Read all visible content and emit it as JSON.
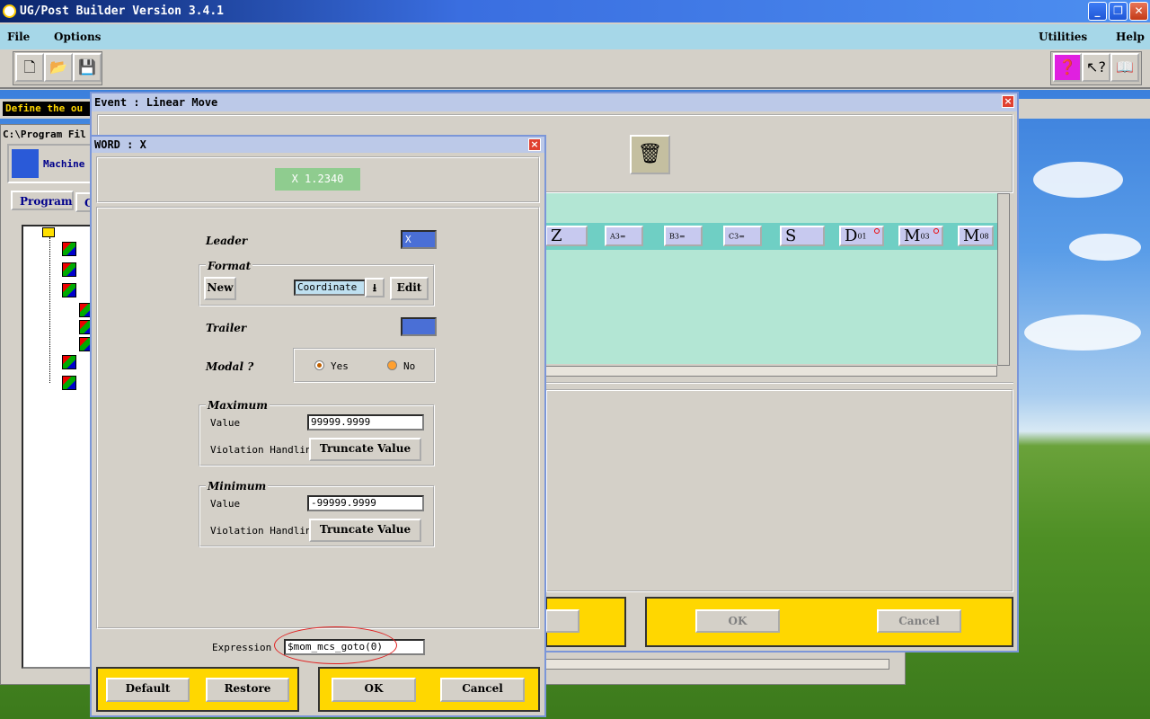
{
  "main_window": {
    "title": "UG/Post Builder Version 3.4.1",
    "menus_left": [
      "File",
      "Options"
    ],
    "menus_right": [
      "Utilities",
      "Help"
    ],
    "minimize": "_",
    "maximize": "❐",
    "close": "✕"
  },
  "status": {
    "message": "Define the ou",
    "path": "C:\\Program Fil"
  },
  "left_panel": {
    "machine_label": "Machine",
    "tabs": [
      "Program",
      "G"
    ]
  },
  "event_window": {
    "title": "Event : Linear Move",
    "blocks": [
      {
        "label": "Z",
        "small": ""
      },
      {
        "label": "",
        "small": "A3="
      },
      {
        "label": "",
        "small": "B3="
      },
      {
        "label": "",
        "small": "C3="
      },
      {
        "label": "S",
        "small": ""
      },
      {
        "label": "D",
        "small": "01"
      },
      {
        "label": "M",
        "small": "03"
      },
      {
        "label": "M",
        "small": "08"
      }
    ],
    "ok_label": "OK",
    "cancel_label": "Cancel"
  },
  "word_dialog": {
    "title": "WORD : X",
    "preview": "X   1.2340",
    "leader_label": "Leader",
    "leader_value": "X",
    "format_label": "Format",
    "new_label": "New",
    "format_value": "Coordinate",
    "edit_label": "Edit",
    "trailer_label": "Trailer",
    "modal_label": "Modal ?",
    "modal_yes": "Yes",
    "modal_no": "No",
    "maximum_label": "Maximum",
    "max_value_label": "Value",
    "max_value": "99999.9999",
    "max_violation_label": "Violation Handling",
    "max_violation_value": "Truncate Value",
    "minimum_label": "Minimum",
    "min_value_label": "Value",
    "min_value": "-99999.9999",
    "min_violation_label": "Violation Handling",
    "min_violation_value": "Truncate Value",
    "expression_label": "Expression",
    "expression_value": "$mom_mcs_goto(0)",
    "default_label": "Default",
    "restore_label": "Restore",
    "ok_label": "OK",
    "cancel_label": "Cancel"
  }
}
